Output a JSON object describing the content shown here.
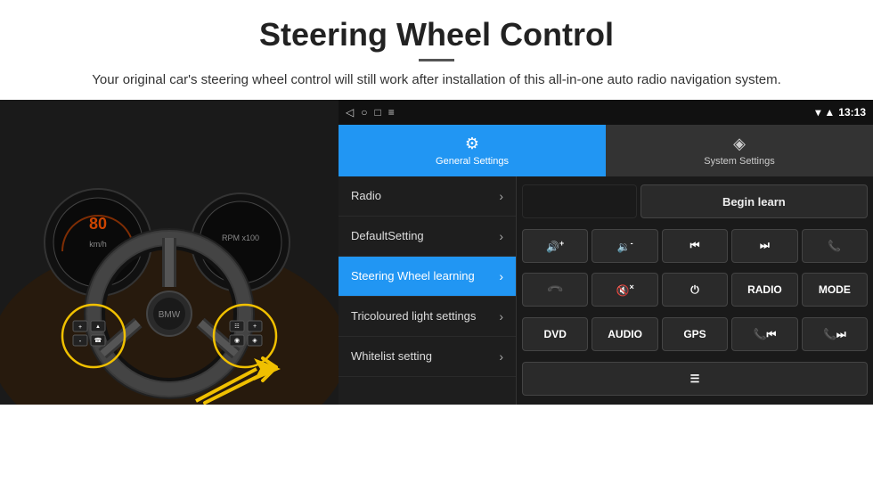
{
  "header": {
    "title": "Steering Wheel Control",
    "divider": true,
    "subtitle": "Your original car's steering wheel control will still work after installation of this all-in-one auto radio navigation system."
  },
  "status_bar": {
    "back_icon": "◁",
    "home_icon": "○",
    "recents_icon": "□",
    "menu_icon": "≡",
    "signal_icon": "▾",
    "wifi_icon": "▲",
    "time": "13:13"
  },
  "tabs": [
    {
      "id": "general",
      "label": "General Settings",
      "icon": "⚙",
      "active": true
    },
    {
      "id": "system",
      "label": "System Settings",
      "icon": "◈",
      "active": false
    }
  ],
  "menu_items": [
    {
      "id": "radio",
      "label": "Radio",
      "active": false
    },
    {
      "id": "default",
      "label": "DefaultSetting",
      "active": false
    },
    {
      "id": "steering",
      "label": "Steering Wheel learning",
      "active": true
    },
    {
      "id": "tricoloured",
      "label": "Tricoloured light settings",
      "active": false
    },
    {
      "id": "whitelist",
      "label": "Whitelist setting",
      "active": false
    }
  ],
  "controls": {
    "begin_learn_label": "Begin learn",
    "row1": [
      {
        "id": "vol-up",
        "icon": "🔊+",
        "label": "VOL+"
      },
      {
        "id": "vol-down",
        "icon": "🔉-",
        "label": "VOL-"
      },
      {
        "id": "prev",
        "icon": "⏮",
        "label": "PREV"
      },
      {
        "id": "next",
        "icon": "⏭",
        "label": "NEXT"
      },
      {
        "id": "call",
        "icon": "📞",
        "label": "CALL"
      }
    ],
    "row2": [
      {
        "id": "hang-up",
        "icon": "↩",
        "label": "HANG"
      },
      {
        "id": "mute",
        "icon": "🔇",
        "label": "MUTE"
      },
      {
        "id": "power",
        "icon": "⏻",
        "label": "PWR"
      },
      {
        "id": "radio-btn",
        "icon": "",
        "label": "RADIO"
      },
      {
        "id": "mode",
        "icon": "",
        "label": "MODE"
      }
    ],
    "row3": [
      {
        "id": "dvd",
        "icon": "",
        "label": "DVD"
      },
      {
        "id": "audio",
        "icon": "",
        "label": "AUDIO"
      },
      {
        "id": "gps",
        "icon": "",
        "label": "GPS"
      },
      {
        "id": "tel-prev",
        "icon": "📞⏮",
        "label": "TEL-PREV"
      },
      {
        "id": "tel-next",
        "icon": "📞⏭",
        "label": "TEL-NEXT"
      }
    ],
    "row4": [
      {
        "id": "custom",
        "icon": "≡",
        "label": "CUSTOM"
      }
    ]
  }
}
